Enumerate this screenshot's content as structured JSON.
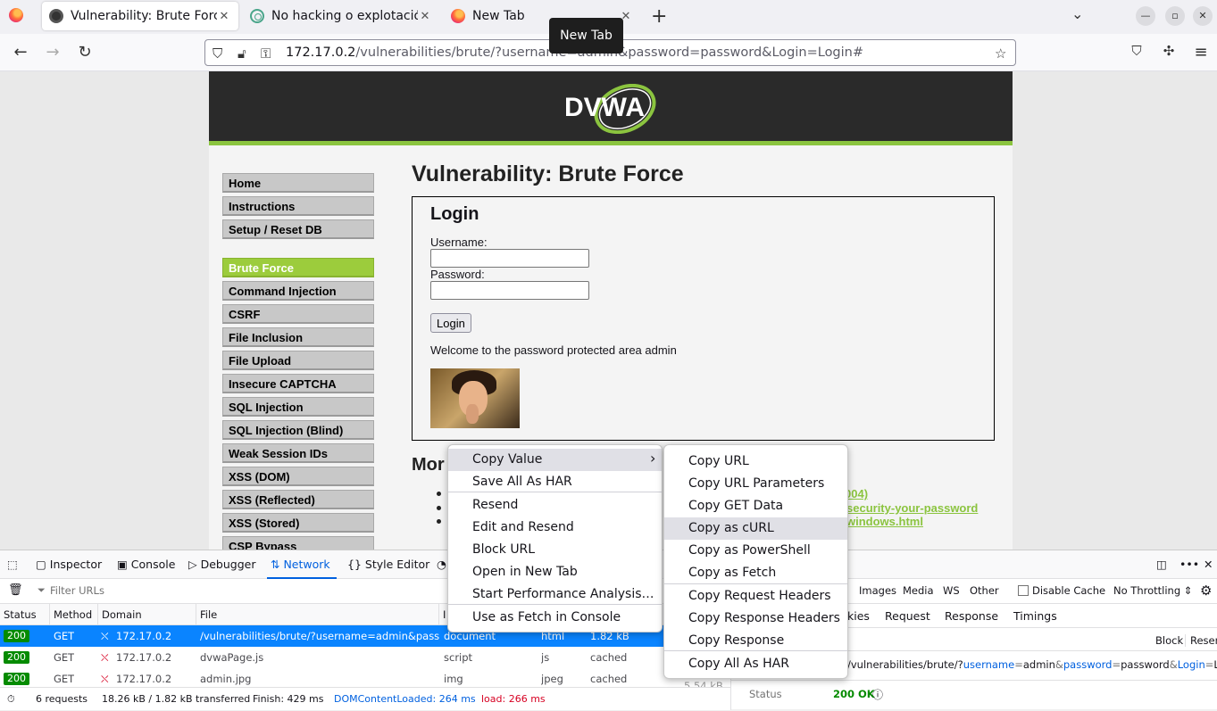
{
  "browser": {
    "tabs": [
      {
        "title": "Vulnerability: Brute Force",
        "active": true
      },
      {
        "title": "No hacking o explotación",
        "active": false
      },
      {
        "title": "New Tab",
        "active": false
      }
    ],
    "tooltip": "New Tab",
    "url_host": "172.17.0.2",
    "url_rest": "/vulnerabilities/brute/?username=admin&password=password&Login=Login#"
  },
  "dvwa": {
    "logo_text": "DVWA",
    "menu_group1": [
      "Home",
      "Instructions",
      "Setup / Reset DB"
    ],
    "menu_group2": [
      "Brute Force",
      "Command Injection",
      "CSRF",
      "File Inclusion",
      "File Upload",
      "Insecure CAPTCHA",
      "SQL Injection",
      "SQL Injection (Blind)",
      "Weak Session IDs",
      "XSS (DOM)",
      "XSS (Reflected)",
      "XSS (Stored)",
      "CSP Bypass"
    ],
    "active_item": "Brute Force",
    "page_title": "Vulnerability: Brute Force",
    "login_title": "Login",
    "username_label": "Username:",
    "password_label": "Password:",
    "login_button": "Login",
    "welcome": "Welcome to the password protected area admin",
    "more_heading": "Mor",
    "more_links": [
      "004)",
      "security-your-password",
      "windows.html"
    ]
  },
  "devtools": {
    "tabs": [
      "Inspector",
      "Console",
      "Debugger",
      "Network",
      "Style Editor"
    ],
    "active_tab": "Network",
    "filter_placeholder": "Filter URLs",
    "filter_types": [
      "Images",
      "Media",
      "WS",
      "Other"
    ],
    "disable_cache": "Disable Cache",
    "throttling": "No Throttling ⇕",
    "columns": [
      "Status",
      "Method",
      "Domain",
      "File",
      "I"
    ],
    "requests": [
      {
        "status": "200",
        "method": "GET",
        "domain": "172.17.0.2",
        "file": "/vulnerabilities/brute/?username=admin&password=p",
        "initiator": "document",
        "type": "html",
        "transferred": "1.82 kB"
      },
      {
        "status": "200",
        "method": "GET",
        "domain": "172.17.0.2",
        "file": "dvwaPage.js",
        "initiator": "script",
        "type": "js",
        "transferred": "cached"
      },
      {
        "status": "200",
        "method": "GET",
        "domain": "172.17.0.2",
        "file": "admin.jpg",
        "initiator": "img",
        "type": "jpeg",
        "transferred": "cached",
        "size": "5.54 kB"
      }
    ],
    "summary": {
      "requests": "6 requests",
      "transferred": "18.26 kB / 1.82 kB transferred",
      "finish": "Finish: 429 ms",
      "dcl": "DOMContentLoaded: 264 ms",
      "load": "load: 266 ms"
    },
    "details_tabs": [
      "kies",
      "Request",
      "Response",
      "Timings"
    ],
    "details_buttons": [
      "Block",
      "Resend"
    ],
    "details_url_prefix": "/vulnerabilities/brute/?",
    "details_url_params": [
      [
        "username",
        "admin"
      ],
      [
        "password",
        "password"
      ],
      [
        "Login",
        "Login"
      ]
    ],
    "status_label": "Status",
    "status_value": "200 OK"
  },
  "context_menu": {
    "items": [
      "Copy Value",
      "Save All As HAR",
      "Resend",
      "Edit and Resend",
      "Block URL",
      "Open in New Tab",
      "Start Performance Analysis…",
      "Use as Fetch in Console"
    ],
    "highlighted": "Copy Value"
  },
  "submenu": {
    "items": [
      "Copy URL",
      "Copy URL Parameters",
      "Copy GET Data",
      "Copy as cURL",
      "Copy as PowerShell",
      "Copy as Fetch",
      "Copy Request Headers",
      "Copy Response Headers",
      "Copy Response",
      "Copy All As HAR"
    ],
    "highlighted": "Copy as cURL"
  }
}
